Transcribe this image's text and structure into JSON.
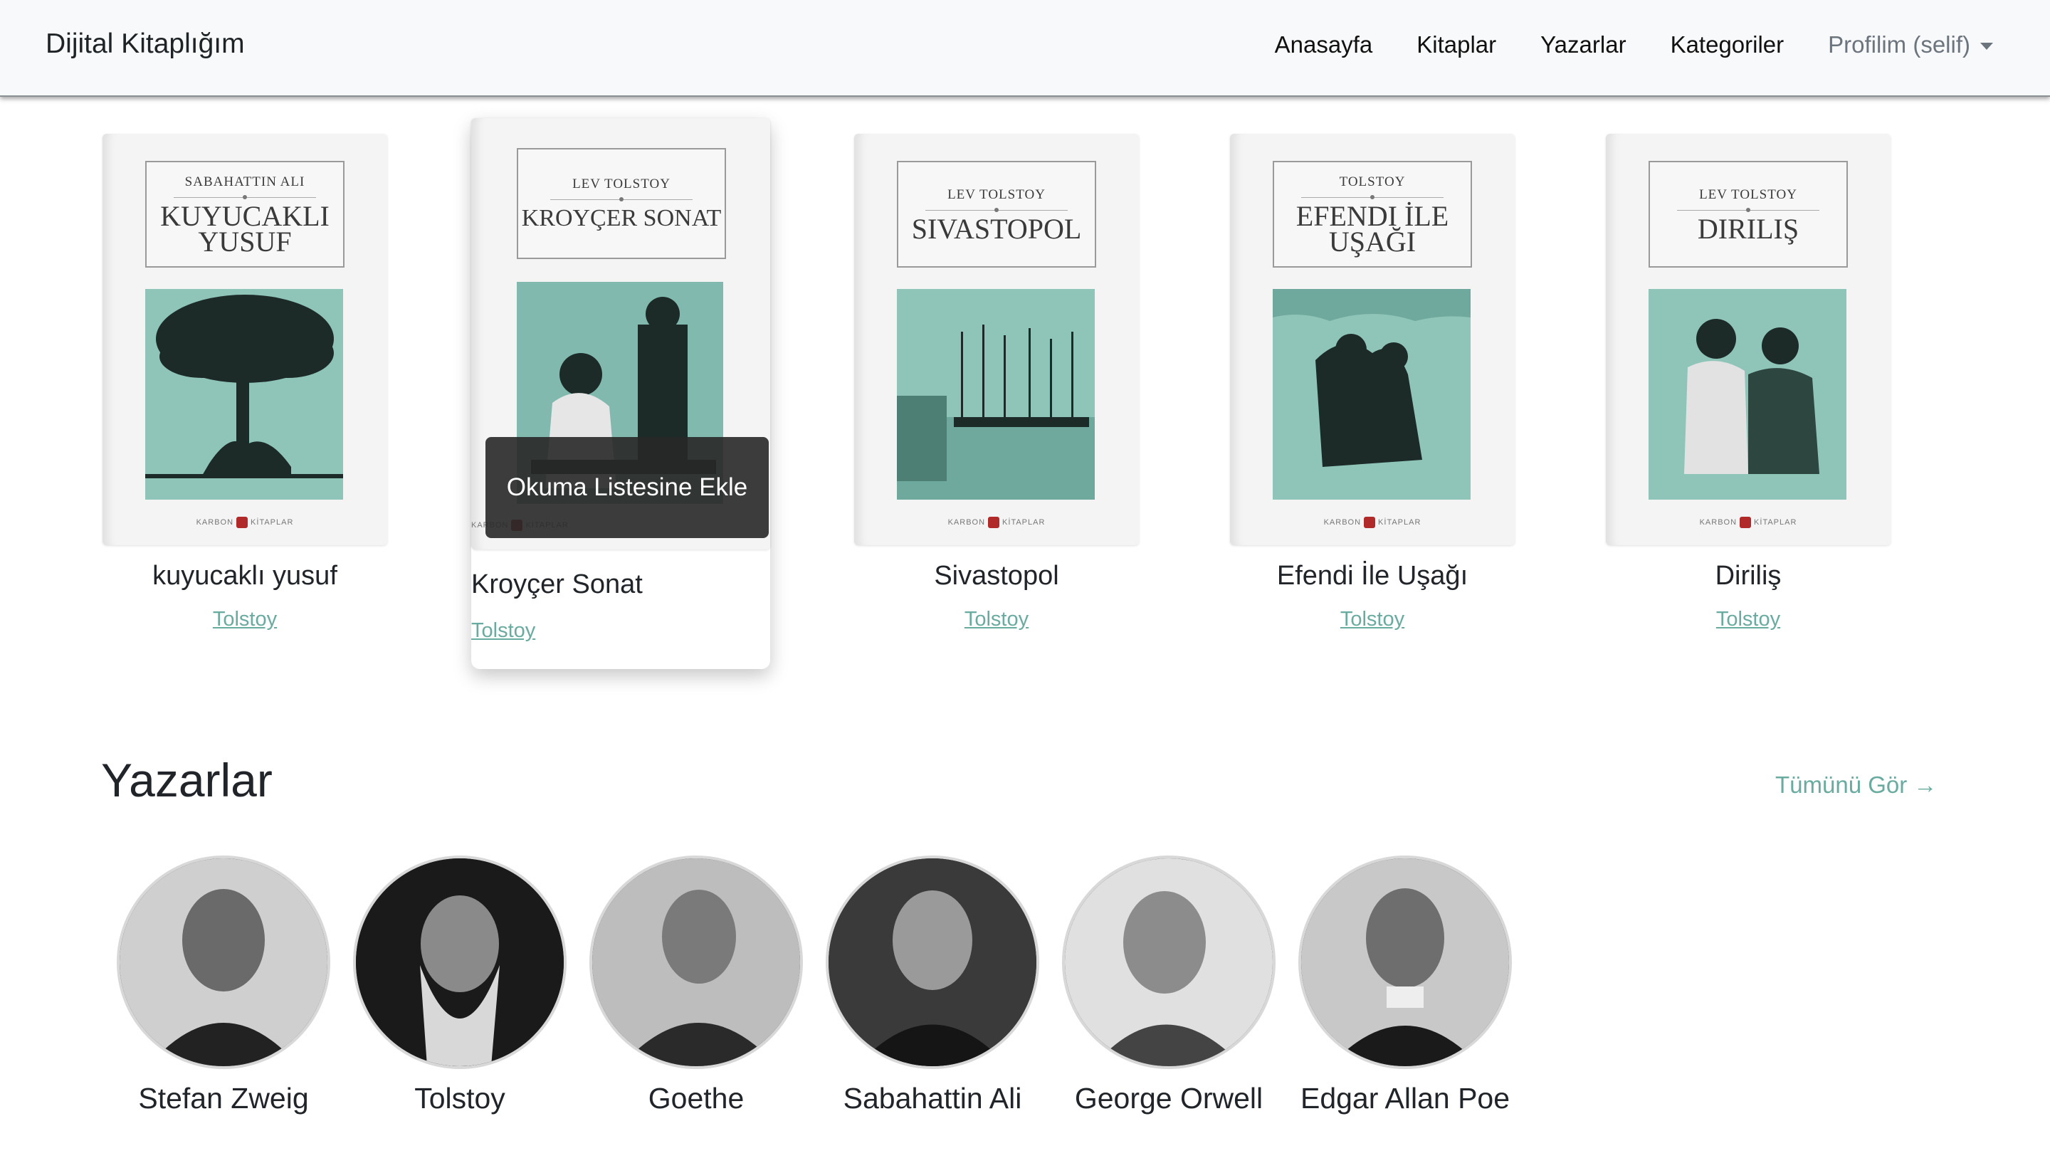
{
  "navbar": {
    "brand": "Dijital Kitaplığım",
    "links": [
      "Anasayfa",
      "Kitaplar",
      "Yazarlar",
      "Kategoriler"
    ],
    "profile": "Profilim (selif)"
  },
  "books": [
    {
      "title": "kuyucaklı yusuf",
      "author": "Tolstoy",
      "cover_author": "Sabahattin Ali",
      "cover_title": "Kuyucaklı Yusuf"
    },
    {
      "title": "Kroyçer Sonat",
      "author": "Tolstoy",
      "cover_author": "Lev Tolstoy",
      "cover_title": "Kroyçer Sonat"
    },
    {
      "title": "Sivastopol",
      "author": "Tolstoy",
      "cover_author": "Lev Tolstoy",
      "cover_title": "Sivastopol"
    },
    {
      "title": "Efendi İle Uşağı",
      "author": "Tolstoy",
      "cover_author": "Tolstoy",
      "cover_title": "Efendi İle Uşağı"
    },
    {
      "title": "Diriliş",
      "author": "Tolstoy",
      "cover_author": "Lev Tolstoy",
      "cover_title": "Diriliş"
    }
  ],
  "publisher": "KARBON KİTAPLAR",
  "hover_button": "Okuma Listesine Ekle",
  "authors_section": {
    "title": "Yazarlar",
    "see_all": "Tümünü Gör →",
    "authors": [
      "Stefan Zweig",
      "Tolstoy",
      "Goethe",
      "Sabahattin Ali",
      "George Orwell",
      "Edgar Allan Poe"
    ]
  },
  "colors": {
    "accent": "#6aaba0",
    "cover_art": "#8fc4b8"
  }
}
